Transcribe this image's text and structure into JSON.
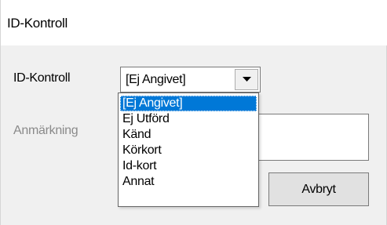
{
  "window": {
    "title": "ID-Kontroll"
  },
  "form": {
    "id_label": "ID-Kontroll",
    "remark_label": "Anmärkning",
    "combo_value": "[Ej Angivet]",
    "options": [
      "[Ej Angivet]",
      "Ej Utförd",
      "Känd",
      "Körkort",
      "Id-kort",
      "Annat"
    ],
    "selected_index": 0,
    "cancel_label": "Avbryt"
  },
  "icons": {
    "dropdown_arrow": "chevron-down-icon"
  }
}
